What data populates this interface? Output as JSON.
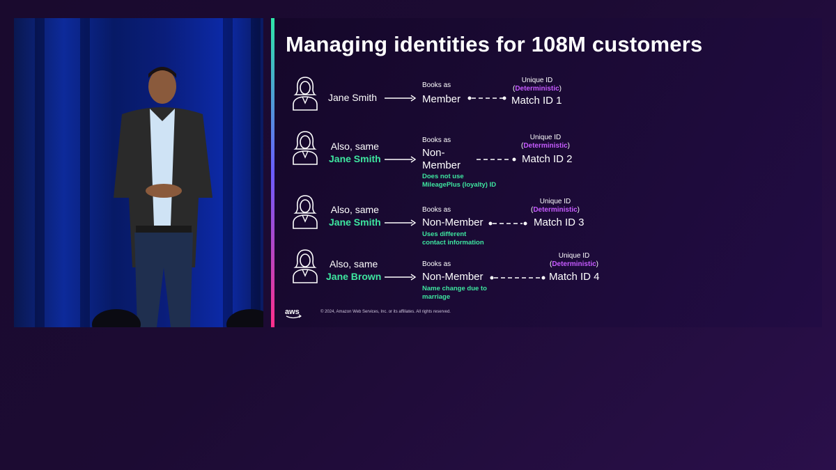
{
  "slide": {
    "title": "Managing identities for 108M customers",
    "books_as": "Books as",
    "unique_id": "Unique ID",
    "deterministic": "Deterministic",
    "rows": [
      {
        "name_plain": "",
        "name_highlight": "Jane Smith",
        "member_type": "Member",
        "note": "",
        "match_id": "Match ID 1"
      },
      {
        "name_plain": "Also, same",
        "name_highlight": "Jane Smith",
        "member_type": "Non-\nMember",
        "note": "Does not use\nMileagePlus (loyalty) ID",
        "match_id": "Match ID 2"
      },
      {
        "name_plain": "Also, same",
        "name_highlight": "Jane Smith",
        "member_type": "Non-Member",
        "note": "Uses different\ncontact information",
        "match_id": "Match ID 3"
      },
      {
        "name_plain": "Also, same",
        "name_highlight": "Jane Brown",
        "member_type": "Non-Member",
        "note": "Name change due to\nmarriage",
        "match_id": "Match ID 4"
      }
    ],
    "logo": "aws",
    "copyright": "© 2024, Amazon Web Services, Inc. or its affiliates. All rights reserved."
  },
  "colors": {
    "highlight_green": "#3ee6a0",
    "deterministic_purple": "#c65bff"
  }
}
